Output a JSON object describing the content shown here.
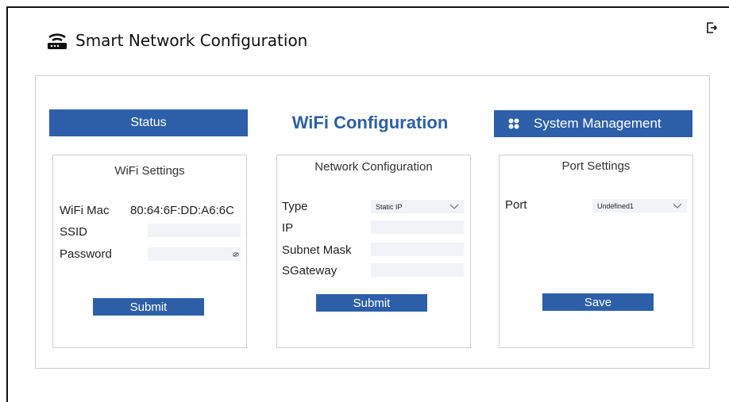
{
  "app": {
    "title": "Smart Network Configuration"
  },
  "nav": {
    "status_label": "Status",
    "page_heading": "WiFi Configuration",
    "system_management_label": "System Management"
  },
  "wifi_settings": {
    "title": "WiFi Settings",
    "mac_label": "WiFi Mac",
    "mac_value": "80:64:6F:DD:A6:6C",
    "ssid_label": "SSID",
    "ssid_value": "",
    "password_label": "Password",
    "password_value": "",
    "submit_label": "Submit"
  },
  "network_configuration": {
    "title": "Network Configuration",
    "type_label": "Type",
    "type_value": "Static IP",
    "ip_label": "IP",
    "ip_value": "",
    "subnet_label": "Subnet Mask",
    "subnet_value": "",
    "gateway_label": "SGateway",
    "gateway_value": "",
    "submit_label": "Submit"
  },
  "port_settings": {
    "title": "Port Settings",
    "port_label": "Port",
    "port_value": "Undefined1",
    "save_label": "Save"
  },
  "colors": {
    "accent": "#2d5fa8",
    "field_bg": "#f1f3f7",
    "border": "#cfcfcf"
  },
  "icons": {
    "header": "router-icon",
    "exit": "exit-icon",
    "system": "grid-icon",
    "password": "eye-off-icon",
    "select": "chevron-down-icon"
  }
}
